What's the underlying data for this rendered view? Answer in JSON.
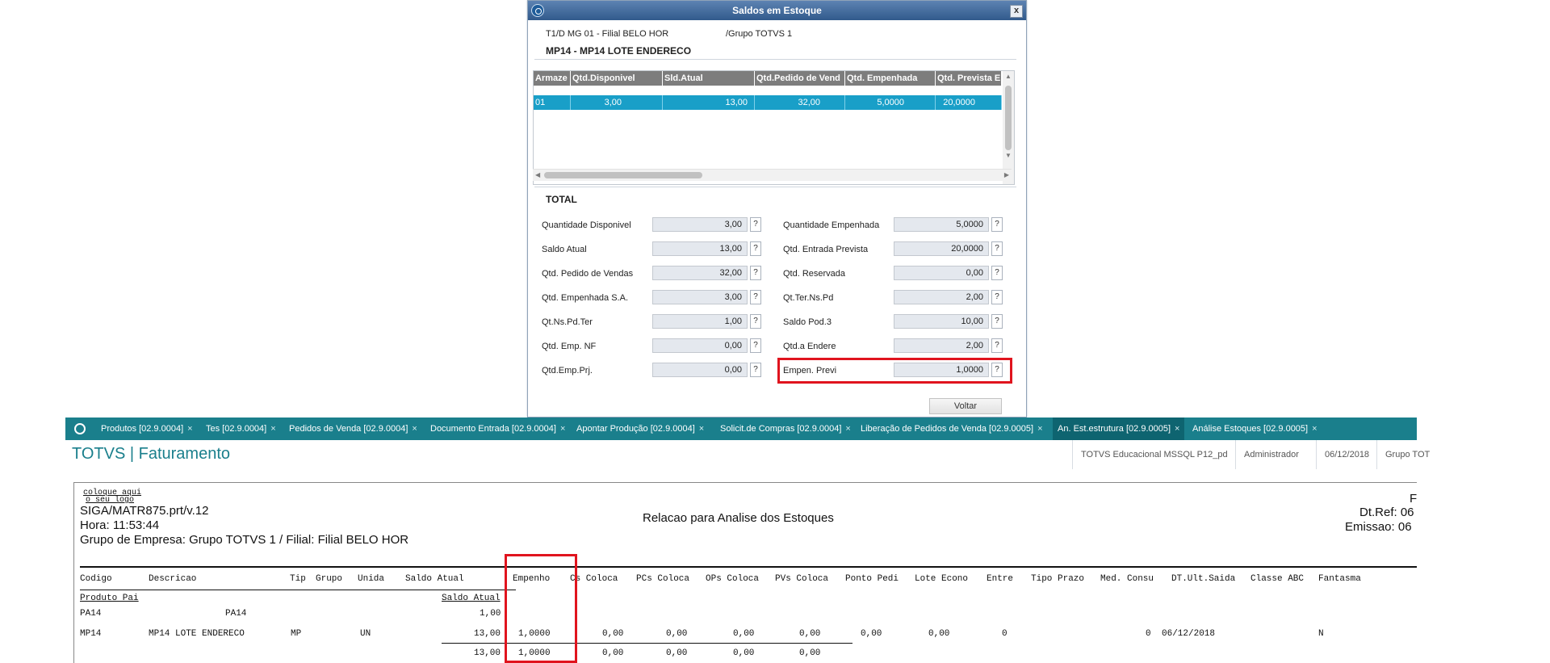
{
  "dialog": {
    "title": "Saldos em Estoque",
    "close": "x",
    "header_left": "T1/D MG 01  - Filial BELO HOR",
    "header_right": "/Grupo TOTVS 1",
    "product": "MP14 - MP14  LOTE ENDERECO",
    "grid": {
      "columns": [
        "Armaze",
        "Qtd.Disponivel",
        "Sld.Atual",
        "Qtd.Pedido de Vend",
        "Qtd. Empenhada",
        "Qtd. Prevista Ent"
      ],
      "row": [
        "01",
        "3,00",
        "13,00",
        "32,00",
        "5,0000",
        "20,0000"
      ]
    },
    "total_label": "TOTAL",
    "fields_left": [
      {
        "label": "Quantidade Disponivel",
        "value": "3,00"
      },
      {
        "label": "Saldo Atual",
        "value": "13,00"
      },
      {
        "label": "Qtd. Pedido de Vendas",
        "value": "32,00"
      },
      {
        "label": "Qtd. Empenhada S.A.",
        "value": "3,00"
      },
      {
        "label": "Qt.Ns.Pd.Ter",
        "value": "1,00"
      },
      {
        "label": "Qtd. Emp. NF",
        "value": "0,00"
      },
      {
        "label": "Qtd.Emp.Prj.",
        "value": "0,00"
      }
    ],
    "fields_right": [
      {
        "label": "Quantidade Empenhada",
        "value": "5,0000"
      },
      {
        "label": "Qtd. Entrada Prevista",
        "value": "20,0000"
      },
      {
        "label": "Qtd. Reservada",
        "value": "0,00"
      },
      {
        "label": "Qt.Ter.Ns.Pd",
        "value": "2,00"
      },
      {
        "label": "Saldo Pod.3",
        "value": "10,00"
      },
      {
        "label": "Qtd.a Endere",
        "value": "2,00"
      },
      {
        "label": "Empen. Previ",
        "value": "1,0000"
      }
    ],
    "help": "?",
    "back_button": "Voltar"
  },
  "tabs": [
    {
      "label": "Produtos [02.9.0004]"
    },
    {
      "label": "Tes [02.9.0004]"
    },
    {
      "label": "Pedidos de Venda [02.9.0004]"
    },
    {
      "label": "Documento Entrada [02.9.0004]"
    },
    {
      "label": "Apontar Produção [02.9.0004]"
    },
    {
      "label": "Solicit.de Compras [02.9.0004]"
    },
    {
      "label": "Liberação de Pedidos de Venda [02.9.0005]"
    },
    {
      "label": "An. Est.estrutura [02.9.0005]"
    },
    {
      "label": "Análise Estoques [02.9.0005]"
    }
  ],
  "tab_close": "×",
  "app": {
    "title": "TOTVS | Faturamento",
    "environment": "TOTVS Educacional MSSQL P12_pd",
    "user": "Administrador",
    "date": "06/12/2018",
    "group": "Grupo TOT"
  },
  "report": {
    "logo_line1": "coloque aqui",
    "logo_line2": "o seu logo",
    "program": "SIGA/MATR875.prt/v.12",
    "time": "Hora: 11:53:44",
    "company": "Grupo de Empresa: Grupo TOTVS 1 / Filial: Filial BELO HOR",
    "title": "Relacao para Analise dos Estoques",
    "page_letter": "F",
    "dtref": "Dt.Ref: 06",
    "emissao": "Emissao: 06",
    "columns": [
      "Codigo",
      "Descricao",
      "Tip",
      "Grupo",
      "Unida",
      "Saldo Atual",
      "Empenho",
      "Cs Coloca",
      "PCs Coloca",
      "OPs Coloca",
      "PVs Coloca",
      "Ponto Pedi",
      "Lote Econo",
      "Entre",
      "Tipo Prazo",
      "Med. Consu",
      "DT.Ult.Saida",
      "Classe ABC",
      "Fantasma"
    ],
    "parent_header": "Produto Pai",
    "parent_saldo_header": "Saldo Atual",
    "parent_row": {
      "code": "PA14",
      "desc": "PA14",
      "saldo": "1,00"
    },
    "item_row": {
      "code": "MP14",
      "desc": "MP14  LOTE ENDERECO",
      "tip": "MP",
      "unid": "UN",
      "saldo": "13,00",
      "empenho": "1,0000",
      "cs": "0,00",
      "pcs": "0,00",
      "ops": "0,00",
      "pvs": "0,00",
      "ponto": "0,00",
      "lote": "0,00",
      "entre": "0",
      "medcons": "0",
      "dtult": "06/12/2018",
      "fantasma": "N"
    },
    "total_row": {
      "saldo": "13,00",
      "empenho": "1,0000",
      "cs": "0,00",
      "pcs": "0,00",
      "ops": "0,00",
      "pvs": "0,00"
    }
  },
  "colors": {
    "accent": "#1a7f8c",
    "highlight_red": "#e0141e",
    "grid_selected": "#199fc8"
  }
}
